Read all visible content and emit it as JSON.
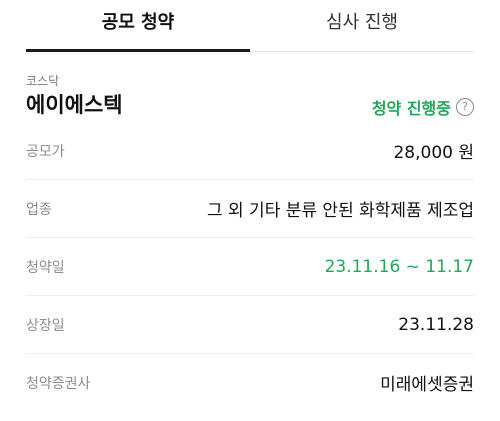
{
  "tabs": [
    {
      "label": "공모 청약",
      "active": true
    },
    {
      "label": "심사 진행",
      "active": false
    }
  ],
  "header": {
    "market": "코스닥",
    "company": "에이에스텍",
    "status": "청약 진행중",
    "help_icon": "?"
  },
  "rows": [
    {
      "label": "공모가",
      "value": "28,000 원"
    },
    {
      "label": "업종",
      "value": "그 외 기타 분류 안된 화학제품 제조업"
    },
    {
      "label": "청약일",
      "value": "23.11.16 ~ 11.17"
    },
    {
      "label": "상장일",
      "value": "23.11.28"
    },
    {
      "label": "청약증권사",
      "value": "미래에셋증권"
    }
  ],
  "colors": {
    "accent_green": "#1fa85a",
    "tab_indicator": "#1a1a1a"
  }
}
